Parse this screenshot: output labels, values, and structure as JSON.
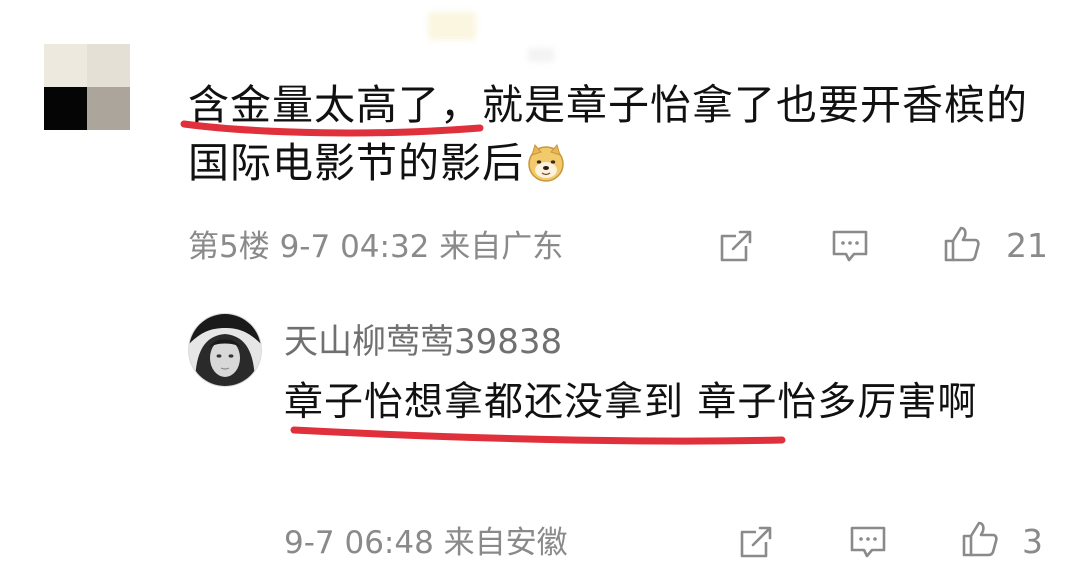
{
  "comment": {
    "text": "含金量太高了，就是章子怡拿了也要开香槟的国际电影节的影后",
    "emoji": "doge-emoji",
    "meta": "第5楼 9-7 04:32 来自广东",
    "like_count": "21"
  },
  "reply": {
    "username": "天山柳莺莺39838",
    "text": "章子怡想拿都还没拿到 章子怡多厉害啊",
    "meta": "9-7 06:48 来自安徽",
    "like_count": "3"
  },
  "icons": {
    "share": "share-icon",
    "comment": "comment-icon",
    "like": "thumbs-up-icon"
  },
  "colors": {
    "underline": "#e0303b",
    "meta_text": "#8a8a8a",
    "body_text": "#111111"
  }
}
